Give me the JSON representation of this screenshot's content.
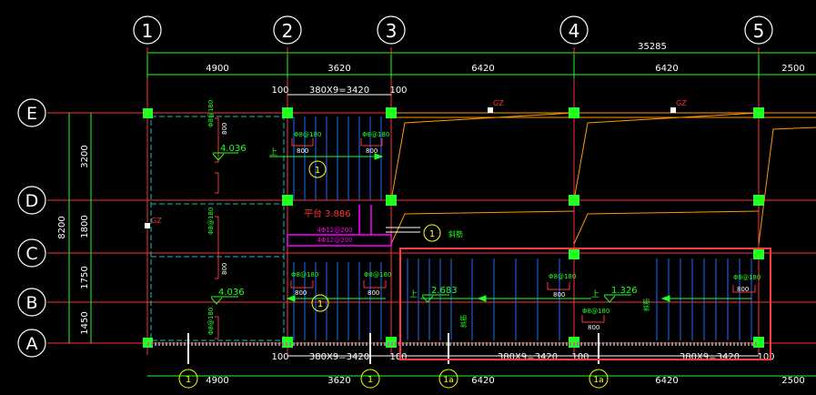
{
  "axes": {
    "col": [
      "1",
      "2",
      "3",
      "4",
      "5"
    ],
    "row": [
      "E",
      "D",
      "C",
      "B",
      "A"
    ]
  },
  "dims": {
    "overall_top": "35285",
    "top": [
      "4900",
      "3620",
      "6420",
      "6420",
      "2500"
    ],
    "bottom": [
      "4900",
      "3620",
      "6420",
      "6420",
      "2500"
    ],
    "offset_100": "100",
    "stair_run": "380X9=3420",
    "left_total": "8200",
    "left": [
      "3200",
      "1800",
      "1750",
      "1450"
    ]
  },
  "labels": {
    "beam_800": "800",
    "rebar": "Φ8@180",
    "rebar_long": "Φ8@180",
    "elev_4036": "4.036",
    "elev_3886": "3.886",
    "elev_2683": "2.683",
    "elev_1326": "1.326",
    "arrow_up": "上",
    "landing": "平台",
    "landing_rebar_a": "4Φ12@200",
    "landing_rebar_b": "4Φ12@200",
    "gz": "GZ",
    "stair_note": "斜筋"
  },
  "bubbles": {
    "stair_section_1": "1",
    "stair_section_2": "1",
    "stair_section_3": "1",
    "bottom_a": "1",
    "bottom_b": "1",
    "bottom_c": "1a",
    "bottom_d": "1a"
  },
  "colors": {
    "background": "#000000",
    "axis_line": "#ff3333",
    "dim_line": "#22ff22",
    "column": "#22ff22",
    "rebar": "#ff3333",
    "stair_tread": "#1e6bff",
    "slab_dash": "#00c8c8",
    "wall_cut": "#ff9900",
    "highlight": "#ff3b3b",
    "landing_beam": "#ff00ff",
    "bubble": "#ffff00",
    "text": "#ffffff"
  }
}
